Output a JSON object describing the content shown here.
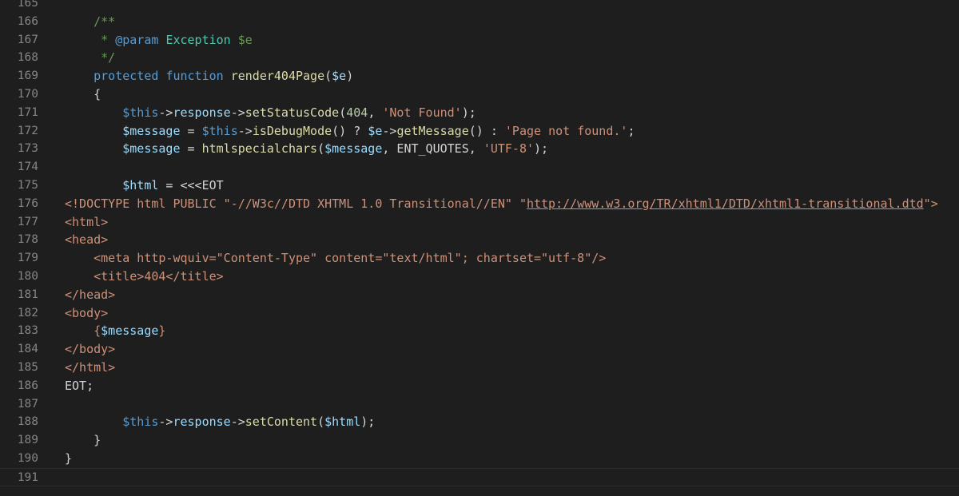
{
  "editor": {
    "lines": [
      {
        "num": "165",
        "tokens": []
      },
      {
        "num": "166",
        "tokens": [
          {
            "t": "    "
          },
          {
            "t": "/**",
            "c": "comment"
          }
        ]
      },
      {
        "num": "167",
        "tokens": [
          {
            "t": "     "
          },
          {
            "t": "* ",
            "c": "comment"
          },
          {
            "t": "@param",
            "c": "doc"
          },
          {
            "t": " "
          },
          {
            "t": "Exception",
            "c": "type"
          },
          {
            "t": " "
          },
          {
            "t": "$e",
            "c": "comment"
          }
        ]
      },
      {
        "num": "168",
        "tokens": [
          {
            "t": "     "
          },
          {
            "t": "*/",
            "c": "comment"
          }
        ]
      },
      {
        "num": "169",
        "tokens": [
          {
            "t": "    "
          },
          {
            "t": "protected",
            "c": "kw"
          },
          {
            "t": " "
          },
          {
            "t": "function",
            "c": "kw"
          },
          {
            "t": " "
          },
          {
            "t": "render404Page",
            "c": "fn"
          },
          {
            "t": "("
          },
          {
            "t": "$e",
            "c": "var"
          },
          {
            "t": ")"
          }
        ]
      },
      {
        "num": "170",
        "tokens": [
          {
            "t": "    {"
          }
        ]
      },
      {
        "num": "171",
        "tokens": [
          {
            "t": "        "
          },
          {
            "t": "$this",
            "c": "kw"
          },
          {
            "t": "->"
          },
          {
            "t": "response",
            "c": "var"
          },
          {
            "t": "->"
          },
          {
            "t": "setStatusCode",
            "c": "fn"
          },
          {
            "t": "("
          },
          {
            "t": "404",
            "c": "num"
          },
          {
            "t": ", "
          },
          {
            "t": "'Not Found'",
            "c": "str"
          },
          {
            "t": ");"
          }
        ]
      },
      {
        "num": "172",
        "tokens": [
          {
            "t": "        "
          },
          {
            "t": "$message",
            "c": "var"
          },
          {
            "t": " = "
          },
          {
            "t": "$this",
            "c": "kw"
          },
          {
            "t": "->"
          },
          {
            "t": "isDebugMode",
            "c": "fn"
          },
          {
            "t": "() ? "
          },
          {
            "t": "$e",
            "c": "var"
          },
          {
            "t": "->"
          },
          {
            "t": "getMessage",
            "c": "fn"
          },
          {
            "t": "() : "
          },
          {
            "t": "'Page not found.'",
            "c": "str"
          },
          {
            "t": ";"
          }
        ]
      },
      {
        "num": "173",
        "tokens": [
          {
            "t": "        "
          },
          {
            "t": "$message",
            "c": "var"
          },
          {
            "t": " = "
          },
          {
            "t": "htmlspecialchars",
            "c": "fn"
          },
          {
            "t": "("
          },
          {
            "t": "$message",
            "c": "var"
          },
          {
            "t": ", ENT_QUOTES, "
          },
          {
            "t": "'UTF-8'",
            "c": "str"
          },
          {
            "t": ");"
          }
        ]
      },
      {
        "num": "174",
        "tokens": []
      },
      {
        "num": "175",
        "tokens": [
          {
            "t": "        "
          },
          {
            "t": "$html",
            "c": "var"
          },
          {
            "t": " = <<<EOT"
          }
        ]
      },
      {
        "num": "176",
        "tokens": [
          {
            "t": "<!DOCTYPE html PUBLIC \"-//W3c//DTD XHTML 1.0 Transitional//EN\" \"",
            "c": "str"
          },
          {
            "t": "http://www.w3.org/TR/xhtml1/DTD/xhtml1-transitional.dtd",
            "c": "link"
          },
          {
            "t": "\">",
            "c": "str"
          }
        ]
      },
      {
        "num": "177",
        "tokens": [
          {
            "t": "<html>",
            "c": "str"
          }
        ]
      },
      {
        "num": "178",
        "tokens": [
          {
            "t": "<head>",
            "c": "str"
          }
        ]
      },
      {
        "num": "179",
        "tokens": [
          {
            "t": "    <meta http-wquiv=\"Content-Type\" content=\"text/html\"; chartset=\"utf-8\"/>",
            "c": "str"
          }
        ]
      },
      {
        "num": "180",
        "tokens": [
          {
            "t": "    <title>404</title>",
            "c": "str"
          }
        ]
      },
      {
        "num": "181",
        "tokens": [
          {
            "t": "</head>",
            "c": "str"
          }
        ]
      },
      {
        "num": "182",
        "tokens": [
          {
            "t": "<body>",
            "c": "str"
          }
        ]
      },
      {
        "num": "183",
        "tokens": [
          {
            "t": "    {",
            "c": "str"
          },
          {
            "t": "$message",
            "c": "var"
          },
          {
            "t": "}",
            "c": "str"
          }
        ]
      },
      {
        "num": "184",
        "tokens": [
          {
            "t": "</body>",
            "c": "str"
          }
        ]
      },
      {
        "num": "185",
        "tokens": [
          {
            "t": "</html>",
            "c": "str"
          }
        ]
      },
      {
        "num": "186",
        "tokens": [
          {
            "t": "EOT;"
          }
        ]
      },
      {
        "num": "187",
        "tokens": []
      },
      {
        "num": "188",
        "tokens": [
          {
            "t": "        "
          },
          {
            "t": "$this",
            "c": "kw"
          },
          {
            "t": "->"
          },
          {
            "t": "response",
            "c": "var"
          },
          {
            "t": "->"
          },
          {
            "t": "setContent",
            "c": "fn"
          },
          {
            "t": "("
          },
          {
            "t": "$html",
            "c": "var"
          },
          {
            "t": ");"
          }
        ]
      },
      {
        "num": "189",
        "tokens": [
          {
            "t": "    }"
          }
        ]
      },
      {
        "num": "190",
        "tokens": [
          {
            "t": "}"
          }
        ]
      },
      {
        "num": "191",
        "tokens": []
      }
    ],
    "current_line": "191"
  }
}
